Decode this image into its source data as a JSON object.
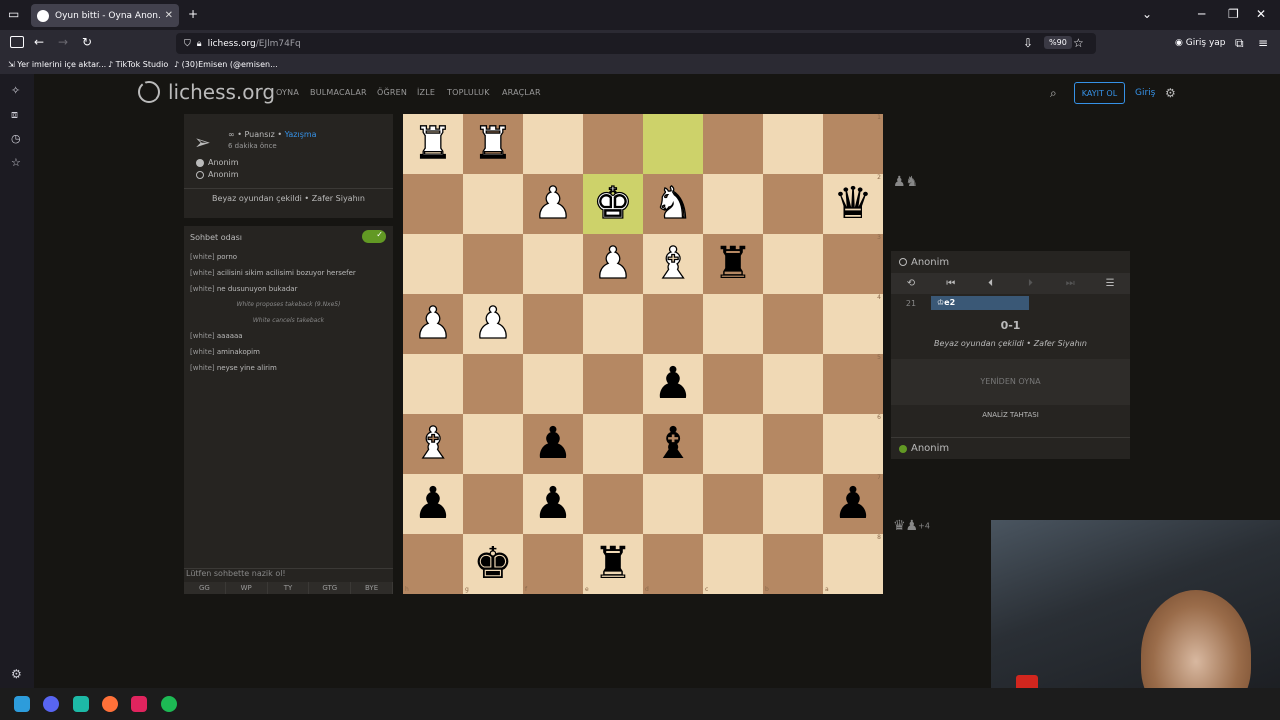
{
  "browser": {
    "tab_title": "Oyun bitti - Oyna Anon. • liches",
    "url_domain": "lichess.org",
    "url_path": "/EJlm74Fq",
    "zoom": "%90",
    "signin": "Giriş yap",
    "bookmarks": [
      "Yer imlerini içe aktar...",
      "TikTok Studio",
      "(30)Emisen (@emisen..."
    ]
  },
  "site": {
    "logo": "lichess.org",
    "menu": [
      "OYNA",
      "BULMACALAR",
      "ÖĞREN",
      "İZLE",
      "TOPLULUK",
      "ARAÇLAR"
    ],
    "signup": "KAYIT OL",
    "login": "Giriş"
  },
  "game_info": {
    "mode_prefix": "∞ • Puansız • ",
    "mode_link": "Yazışma",
    "time_ago": "6 dakika önce",
    "player_white": "Anonim",
    "player_black": "Anonim",
    "status": "Beyaz oyundan çekildi • Zafer Siyahın"
  },
  "chat": {
    "title": "Sohbet odası",
    "messages": [
      {
        "user": "[white]",
        "text": "porno"
      },
      {
        "user": "[white]",
        "text": "acilisini sikim acilisimi bozuyor hersefer"
      },
      {
        "user": "[white]",
        "text": "ne dusunuyon bukadar"
      },
      {
        "system": "White proposes takeback (9.Nxe5)"
      },
      {
        "system": "White cancels takeback"
      },
      {
        "user": "[white]",
        "text": "aaaaaa"
      },
      {
        "user": "[white]",
        "text": "aminakopim"
      },
      {
        "user": "[white]",
        "text": "neyse yine alirim"
      }
    ],
    "input_placeholder": "Lütfen sohbette nazik ol!",
    "presets": [
      "GG",
      "WP",
      "TY",
      "GTG",
      "BYE"
    ]
  },
  "board": {
    "orientation": "black",
    "ranks": [
      "1",
      "2",
      "3",
      "4",
      "5",
      "6",
      "7",
      "8"
    ],
    "files": [
      "h",
      "g",
      "f",
      "e",
      "d",
      "c",
      "b",
      "a"
    ]
  },
  "right_panel": {
    "top_player": "Anonim",
    "move_number": "21",
    "move": "♔e2",
    "result": "0-1",
    "reason": "Beyaz oyundan çekildi • Zafer Siyahın",
    "rematch": "YENİDEN OYNA",
    "analysis": "ANALİZ TAHTASI",
    "bottom_player": "Anonim",
    "captured_top": "♟♞",
    "captured_bottom": "♛♟",
    "material_diff": "+4"
  }
}
